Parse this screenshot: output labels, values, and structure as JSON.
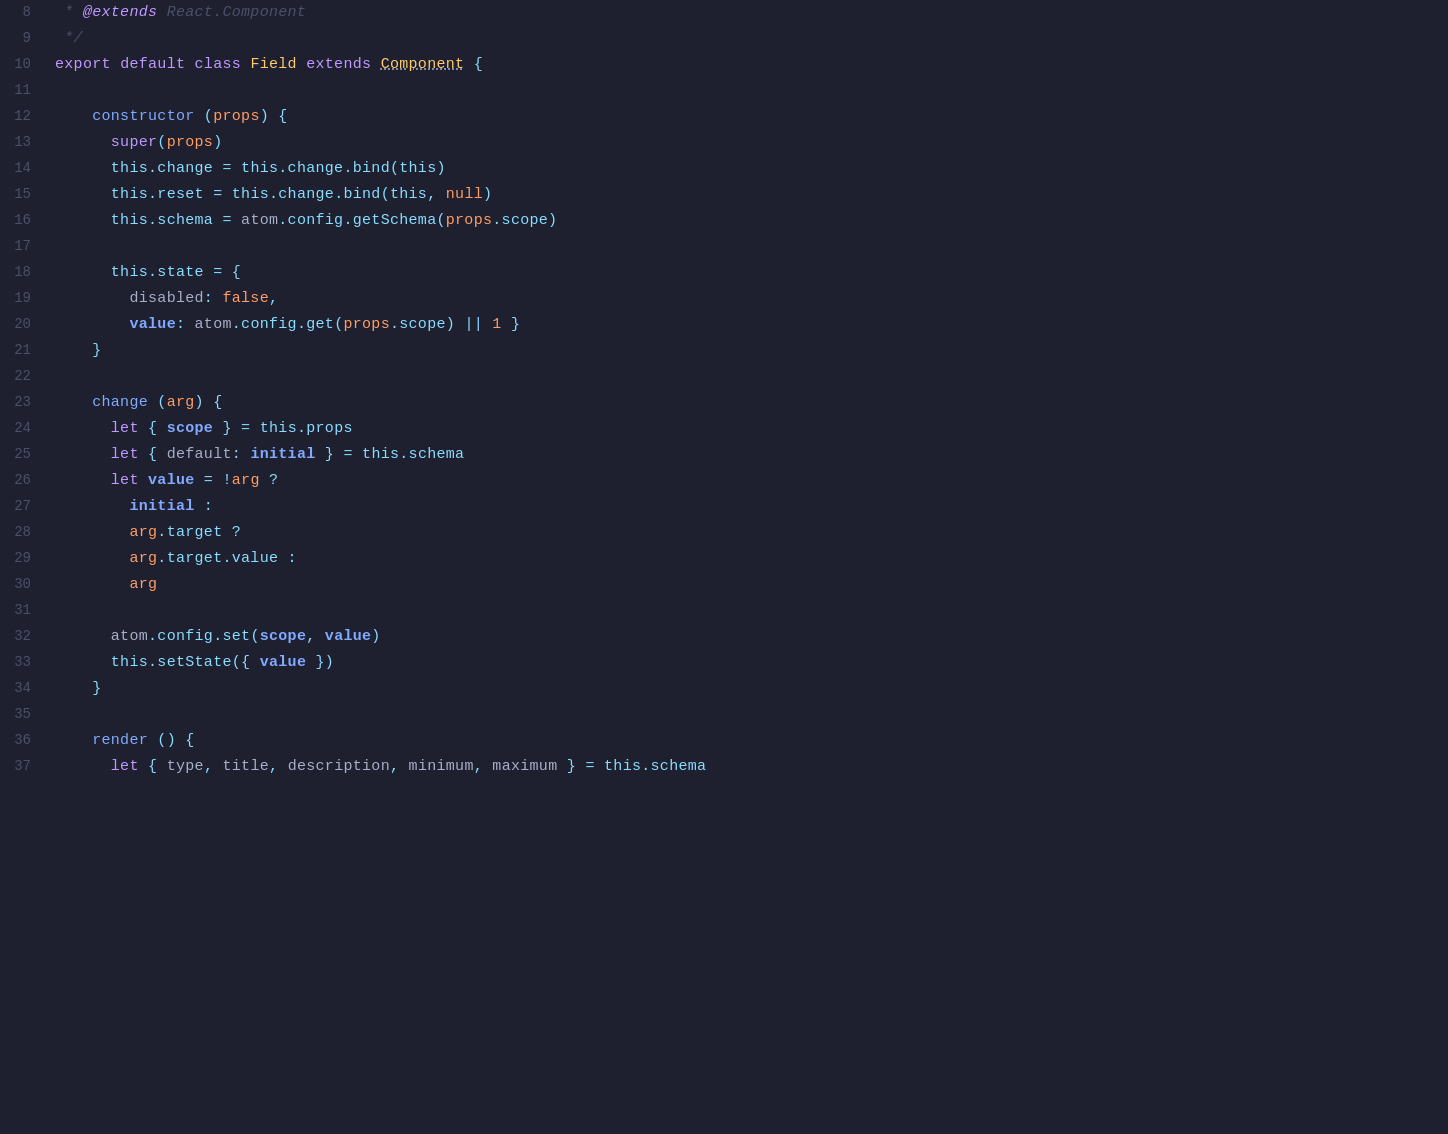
{
  "editor": {
    "background": "#1e2030",
    "lines": [
      {
        "num": 8,
        "tokens": "line8"
      },
      {
        "num": 9,
        "tokens": "line9"
      },
      {
        "num": 10,
        "tokens": "line10"
      },
      {
        "num": 11,
        "tokens": "line11"
      },
      {
        "num": 12,
        "tokens": "line12"
      },
      {
        "num": 13,
        "tokens": "line13"
      },
      {
        "num": 14,
        "tokens": "line14"
      },
      {
        "num": 15,
        "tokens": "line15"
      },
      {
        "num": 16,
        "tokens": "line16"
      },
      {
        "num": 17,
        "tokens": "line17"
      },
      {
        "num": 18,
        "tokens": "line18"
      },
      {
        "num": 19,
        "tokens": "line19"
      },
      {
        "num": 20,
        "tokens": "line20"
      },
      {
        "num": 21,
        "tokens": "line21"
      },
      {
        "num": 22,
        "tokens": "line22"
      },
      {
        "num": 23,
        "tokens": "line23"
      },
      {
        "num": 24,
        "tokens": "line24"
      },
      {
        "num": 25,
        "tokens": "line25"
      },
      {
        "num": 26,
        "tokens": "line26"
      },
      {
        "num": 27,
        "tokens": "line27"
      },
      {
        "num": 28,
        "tokens": "line28"
      },
      {
        "num": 29,
        "tokens": "line29"
      },
      {
        "num": 30,
        "tokens": "line30"
      },
      {
        "num": 31,
        "tokens": "line31"
      },
      {
        "num": 32,
        "tokens": "line32"
      },
      {
        "num": 33,
        "tokens": "line33"
      },
      {
        "num": 34,
        "tokens": "line34"
      },
      {
        "num": 35,
        "tokens": "line35"
      },
      {
        "num": 36,
        "tokens": "line36"
      },
      {
        "num": 37,
        "tokens": "line37"
      }
    ]
  }
}
